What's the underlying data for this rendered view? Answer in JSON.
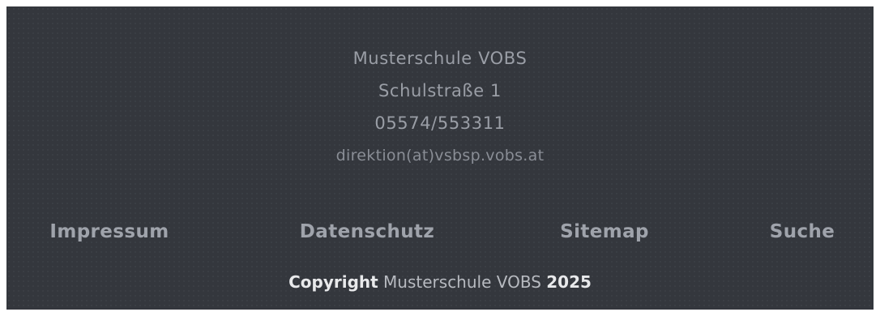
{
  "address": {
    "school_name": "Musterschule VOBS",
    "street": "Schulstraße 1",
    "phone": "05574/553311",
    "email": "direktion(at)vsbsp.vobs.at"
  },
  "nav": {
    "items": [
      {
        "label": "Impressum"
      },
      {
        "label": "Datenschutz"
      },
      {
        "label": "Sitemap"
      },
      {
        "label": "Suche"
      }
    ]
  },
  "copyright": {
    "prefix": "Copyright",
    "name": "Musterschule VOBS",
    "year": "2025"
  }
}
